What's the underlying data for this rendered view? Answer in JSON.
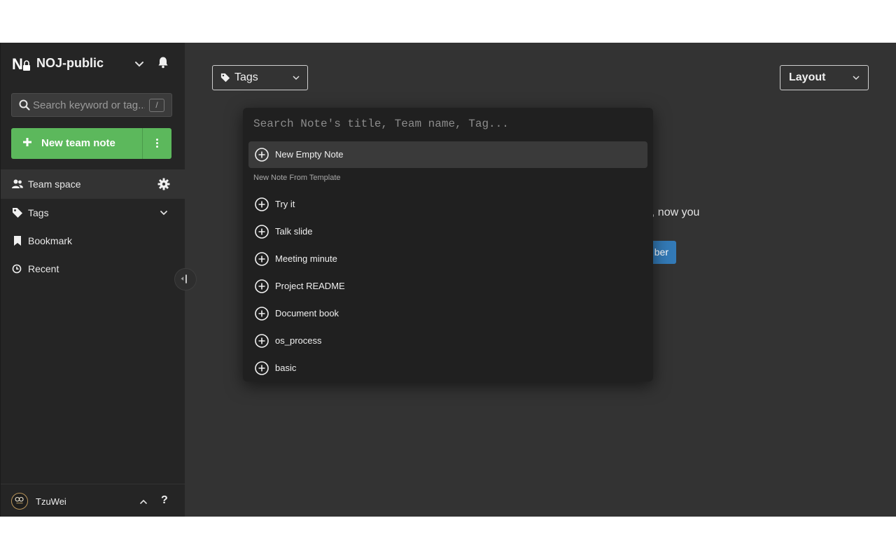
{
  "sidebar": {
    "team_name": "NOJ-public",
    "search": {
      "placeholder": "Search keyword or tag...",
      "shortcut": "/"
    },
    "new_note_label": "New team note",
    "nav": [
      {
        "label": "Team space",
        "icon": "users-icon",
        "right_icon": "gear-icon",
        "active": true
      },
      {
        "label": "Tags",
        "icon": "tag-icon",
        "right_icon": "chevron-down-icon",
        "active": false
      },
      {
        "label": "Bookmark",
        "icon": "bookmark-icon",
        "active": false
      },
      {
        "label": "Recent",
        "icon": "clock-icon",
        "active": false
      }
    ],
    "user": {
      "name": "TzuWei",
      "help": "?"
    }
  },
  "main": {
    "tags_dropdown": "Tags",
    "layout_dropdown": "Layout",
    "background_text": "ce, now you",
    "background_button": "ber"
  },
  "palette": {
    "placeholder": "Search Note's title, Team name, Tag...",
    "new_empty_note": "New Empty Note",
    "section_label": "New Note From Template",
    "templates": [
      "Try it",
      "Talk slide",
      "Meeting minute",
      "Project README",
      "Document book",
      "os_process",
      "basic"
    ]
  },
  "colors": {
    "accent_green": "#5cb85c",
    "accent_blue": "#337ab7",
    "app_bg": "#333333",
    "sidebar_bg": "#252525",
    "palette_bg": "#202020"
  }
}
